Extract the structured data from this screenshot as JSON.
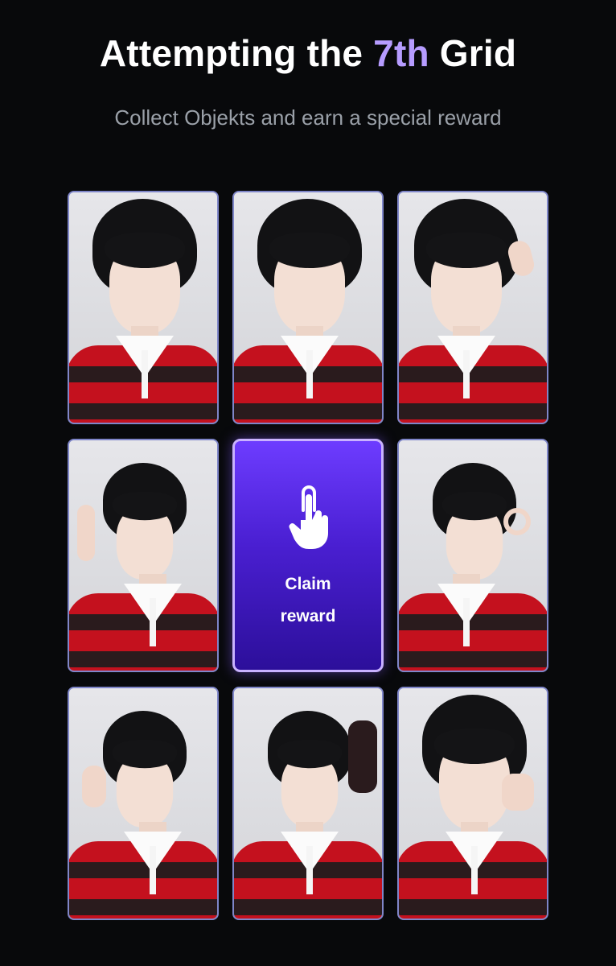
{
  "header": {
    "title_prefix": "Attempting the ",
    "title_accent": "7th",
    "title_suffix": " Grid",
    "subtitle": "Collect Objekts and earn a special reward"
  },
  "grid": {
    "reward": {
      "line1": "Claim",
      "line2": "reward",
      "icon": "tap-hand-icon"
    }
  },
  "colors": {
    "background": "#08090b",
    "accent": "#b69cff",
    "reward_gradient_top": "#6d3cff",
    "reward_gradient_bottom": "#2c0f9a",
    "card_border": "#7f86c9"
  }
}
